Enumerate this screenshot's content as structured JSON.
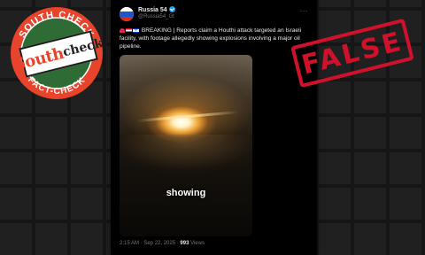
{
  "logo": {
    "ring_top_text": "SOUTH CHECK",
    "ring_bottom_text": "FACT-CHECK",
    "word_part1": "South",
    "word_part2": "check",
    "colors": {
      "ring": "#e8432b",
      "ring_text": "#ffffff",
      "inner": "#2f6b35"
    }
  },
  "tweet": {
    "display_name": "Russia 54",
    "handle": "@Russia54_Gt",
    "text": "BREAKING | Reports claim a Houthi attack targeted an Israeli facility, with footage allegedly showing explosions involving a major oil pipeline.",
    "video_caption": "showing",
    "timestamp": "2:15 AM · Sep 22, 2025 ·",
    "views_count": "993",
    "views_label": "Views",
    "more_icon": "···"
  },
  "stamp": {
    "text": "FALSE",
    "color": "#d0112b"
  }
}
